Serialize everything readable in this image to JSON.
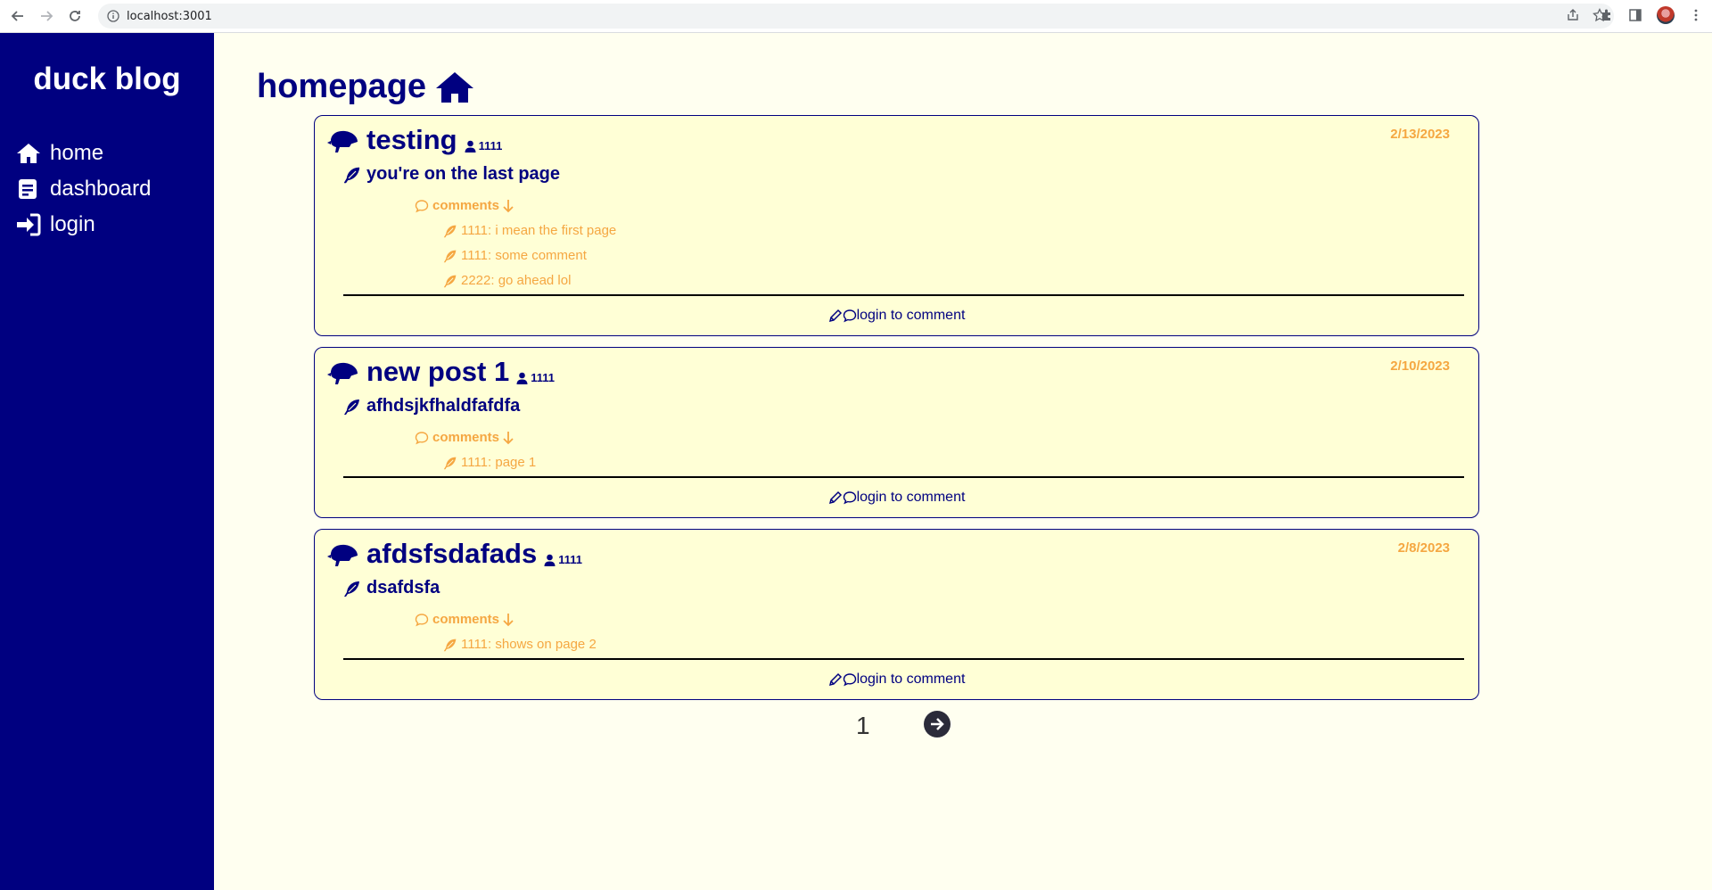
{
  "browser": {
    "url": "localhost:3001"
  },
  "sidebar": {
    "brand": "duck blog",
    "items": [
      {
        "label": "home",
        "icon": "home-icon"
      },
      {
        "label": "dashboard",
        "icon": "dashboard-icon"
      },
      {
        "label": "login",
        "icon": "login-icon"
      }
    ]
  },
  "main": {
    "title": "homepage",
    "posts": [
      {
        "title": "testing",
        "author": "1111",
        "date": "2/13/2023",
        "body": "you're on the last page",
        "comments_label": "comments",
        "comments": [
          "1111: i mean the first page",
          "1111: some comment",
          "2222: go ahead lol"
        ],
        "login_label": "login to comment"
      },
      {
        "title": "new post 1",
        "author": "1111",
        "date": "2/10/2023",
        "body": "afhdsjkfhaldfafdfa",
        "comments_label": "comments",
        "comments": [
          "1111: page 1"
        ],
        "login_label": "login to comment"
      },
      {
        "title": "afdsfsdafads",
        "author": "1111",
        "date": "2/8/2023",
        "body": "dsafdsfa",
        "comments_label": "comments",
        "comments": [
          "1111: shows on page 2"
        ],
        "login_label": "login to comment"
      }
    ],
    "pagination": {
      "current_page": "1"
    }
  },
  "colors": {
    "sidebar_bg": "#000080",
    "accent": "#f5a742",
    "page_bg": "#fffff0",
    "card_bg": "#ffffd6"
  }
}
